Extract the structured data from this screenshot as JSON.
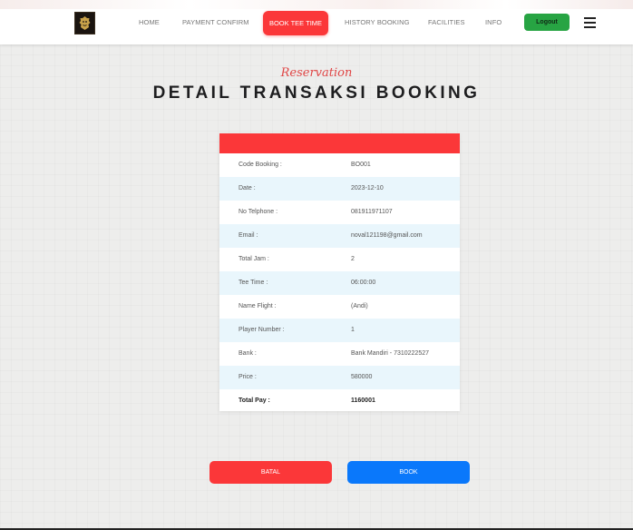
{
  "nav": {
    "items": [
      {
        "label": "HOME"
      },
      {
        "label": "PAYMENT CONFIRM"
      },
      {
        "label": "BOOK TEE TIME"
      },
      {
        "label": "HISTORY BOOKING"
      },
      {
        "label": "FACILITIES"
      },
      {
        "label": "INFO"
      }
    ],
    "active_index": 2,
    "logout_label": "Logout"
  },
  "header": {
    "subtitle": "Reservation",
    "title": "DETAIL TRANSAKSI BOOKING"
  },
  "booking": {
    "rows": [
      {
        "label": "Code Booking :",
        "value": "BO001"
      },
      {
        "label": "Date :",
        "value": "2023-12-10"
      },
      {
        "label": "No Telphone :",
        "value": "081911971107"
      },
      {
        "label": "Email :",
        "value": "noval121198@gmail.com"
      },
      {
        "label": "Total Jam :",
        "value": "2"
      },
      {
        "label": "Tee Time :",
        "value": "06:00:00"
      },
      {
        "label": "Name Flight :",
        "value": "(Andi)"
      },
      {
        "label": "Player Number :",
        "value": "1"
      },
      {
        "label": "Bank :",
        "value": "Bank Mandiri - 7310222527"
      },
      {
        "label": "Price :",
        "value": "580000"
      },
      {
        "label": "Total Pay :",
        "value": "1160001"
      }
    ]
  },
  "actions": {
    "cancel_label": "BATAL",
    "book_label": "BOOK"
  },
  "colors": {
    "accent": "#fb3739",
    "primary": "#0a78fb",
    "success": "#27a443",
    "row_alt": "#e9f6fc"
  }
}
